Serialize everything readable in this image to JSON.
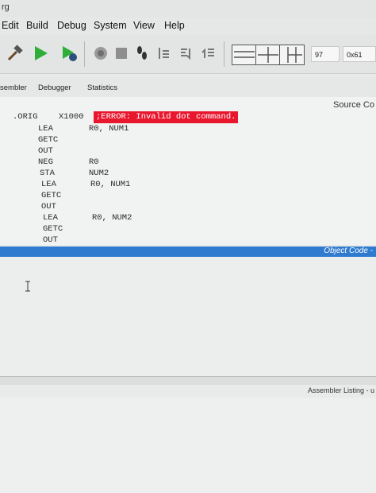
{
  "window": {
    "title_fragment": "rg"
  },
  "menu": [
    "Edit",
    "Build",
    "Debug",
    "System",
    "View",
    "Help"
  ],
  "toolbar": {
    "icons": [
      "hammer-icon",
      "run-icon",
      "run-debug-icon",
      "step-icon",
      "stop-icon",
      "footprints-icon",
      "step-into-icon",
      "step-over-icon",
      "step-out-icon",
      "layout1-icon",
      "layout2-icon",
      "layout3-icon"
    ],
    "field1": "97",
    "field2": "0x61"
  },
  "tabs": [
    "sembler",
    "Debugger",
    "Statistics"
  ],
  "editor": {
    "source_label": "Source Co",
    "error_text": ";ERROR: Invalid dot command.",
    "lines": [
      {
        "op": ".ORIG",
        "arg": "X1000"
      },
      {
        "op": "LEA",
        "arg": "R0, NUM1"
      },
      {
        "op": "GETC",
        "arg": ""
      },
      {
        "op": "OUT",
        "arg": ""
      },
      {
        "op": "NEG",
        "arg": "R0"
      },
      {
        "op": "STA",
        "arg": "NUM2"
      },
      {
        "op": "LEA",
        "arg": "R0, NUM1"
      },
      {
        "op": "GETC",
        "arg": ""
      },
      {
        "op": "OUT",
        "arg": ""
      },
      {
        "op": "LEA",
        "arg": "R0, NUM2"
      },
      {
        "op": "GETC",
        "arg": ""
      },
      {
        "op": "OUT",
        "arg": ""
      }
    ]
  },
  "panels": {
    "object_code": "Object Code -",
    "assembler_listing": "Assembler Listing - u"
  },
  "colors": {
    "error_bg": "#e8172e",
    "accent_blue": "#2f7bd0",
    "run_green": "#2fae3a"
  }
}
